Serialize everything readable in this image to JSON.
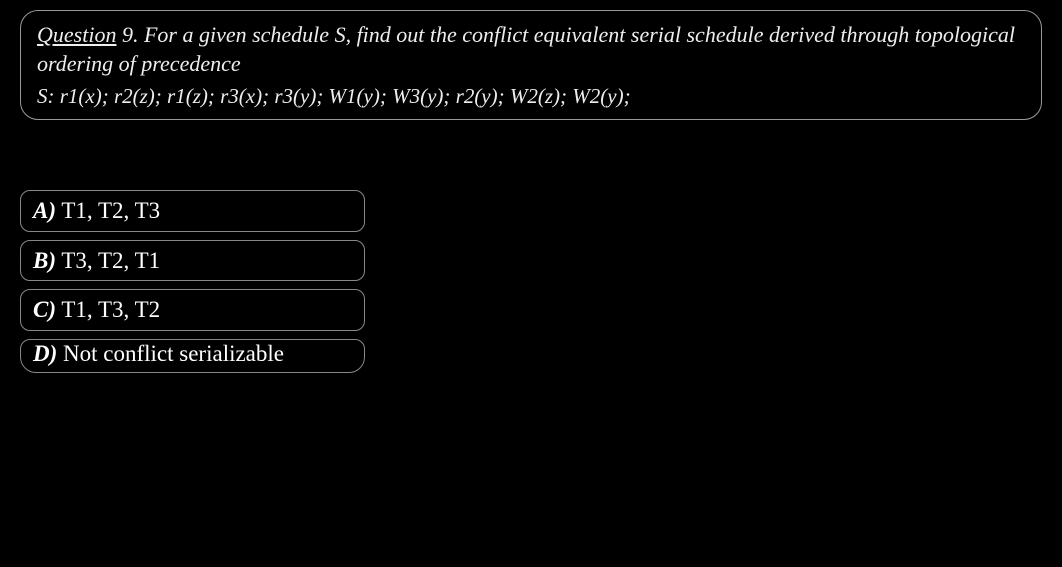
{
  "question": {
    "label": "Question",
    "number": "9.",
    "prompt": "For a given schedule S, find out the conflict equivalent serial schedule derived through topological ordering of precedence",
    "schedule": "S: r1(x); r2(z); r1(z); r3(x); r3(y); W1(y); W3(y); r2(y); W2(z); W2(y);"
  },
  "options": [
    {
      "letter": "A)",
      "text": " T1, T2, T3"
    },
    {
      "letter": "B)",
      "text": " T3, T2, T1"
    },
    {
      "letter": "C)",
      "text": " T1, T3, T2"
    },
    {
      "letter": "D)",
      "text": " Not conflict serializable"
    }
  ]
}
